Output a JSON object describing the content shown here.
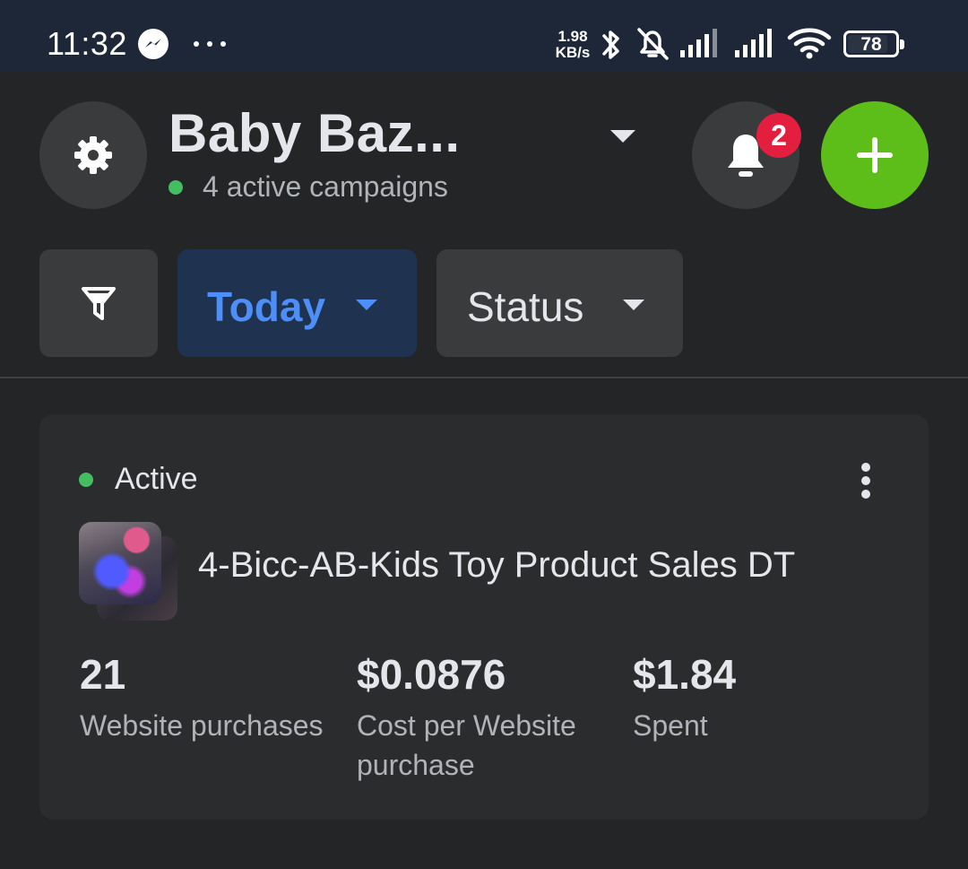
{
  "status_bar": {
    "time": "11:32",
    "notification_icon": "messenger-icon",
    "overflow_icon": "more-dots-icon",
    "network_speed_value": "1.98",
    "network_speed_unit": "KB/s",
    "icons": [
      "bluetooth-icon",
      "bell-muted-icon",
      "signal-icon",
      "signal-icon",
      "wifi-icon"
    ],
    "battery": "78"
  },
  "header": {
    "account_name": "Baby Baz...",
    "active_campaigns": "4 active campaigns",
    "notification_count": "2",
    "colors": {
      "active_dot": "#45bd62",
      "add_button": "#5dbe19",
      "badge": "#e41e3f"
    }
  },
  "filters": {
    "date_label": "Today",
    "status_label": "Status",
    "colors": {
      "date_selected_text": "#4d8ef7",
      "date_selected_bg": "#1f3250"
    }
  },
  "campaign": {
    "status": "Active",
    "name": "4-Bicc-AB-Kids Toy Product Sales DT",
    "metrics": [
      {
        "value": "21",
        "label": "Website purchases"
      },
      {
        "value": "$0.0876",
        "label": "Cost per Website purchase"
      },
      {
        "value": "$1.84",
        "label": "Spent"
      }
    ]
  }
}
